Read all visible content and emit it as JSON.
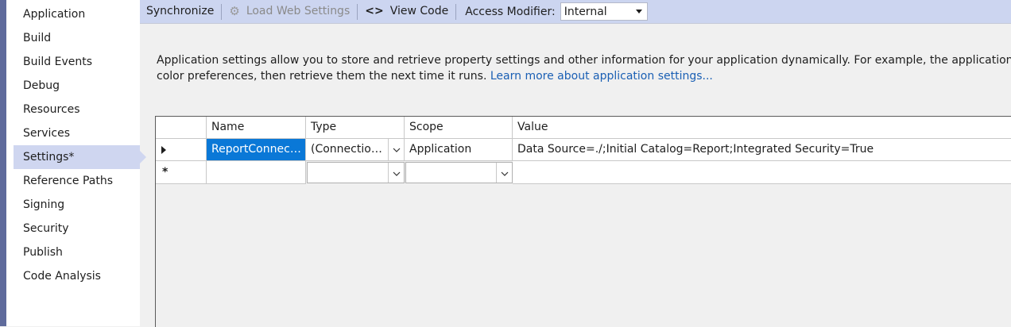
{
  "sidebar": {
    "items": [
      {
        "label": "Application"
      },
      {
        "label": "Build"
      },
      {
        "label": "Build Events"
      },
      {
        "label": "Debug"
      },
      {
        "label": "Resources"
      },
      {
        "label": "Services"
      },
      {
        "label": "Settings*"
      },
      {
        "label": "Reference Paths"
      },
      {
        "label": "Signing"
      },
      {
        "label": "Security"
      },
      {
        "label": "Publish"
      },
      {
        "label": "Code Analysis"
      }
    ],
    "active_index": 6
  },
  "toolbar": {
    "synchronize_label": "Synchronize",
    "load_web_settings_label": "Load Web Settings",
    "view_code_label": "View Code",
    "access_modifier_label": "Access Modifier:",
    "access_modifier_value": "Internal"
  },
  "description": {
    "line1": "Application settings allow you to store and retrieve property settings and other information for your application dynamically. For example, the application can save a user's",
    "line2": "color preferences, then retrieve them the next time it runs.",
    "link": "Learn more about application settings..."
  },
  "grid": {
    "columns": [
      "Name",
      "Type",
      "Scope",
      "Value"
    ],
    "rows": [
      {
        "name": "ReportConnectionString",
        "type": "(Connection string)",
        "scope": "Application",
        "value": "Data Source=./;Initial Catalog=Report;Integrated Security=True"
      }
    ],
    "new_row_marker": "*"
  },
  "icons": {
    "current_row": "row-pointer-icon",
    "dropdown": "chevron-down-icon",
    "view_code": "code-brackets-icon",
    "load_web_settings": "gear-icon"
  },
  "colors": {
    "accent": "#0a78d7",
    "toolbar_bg": "#ccd5f0",
    "active_nav": "#cfd6f0",
    "link": "#1a5fb4"
  }
}
